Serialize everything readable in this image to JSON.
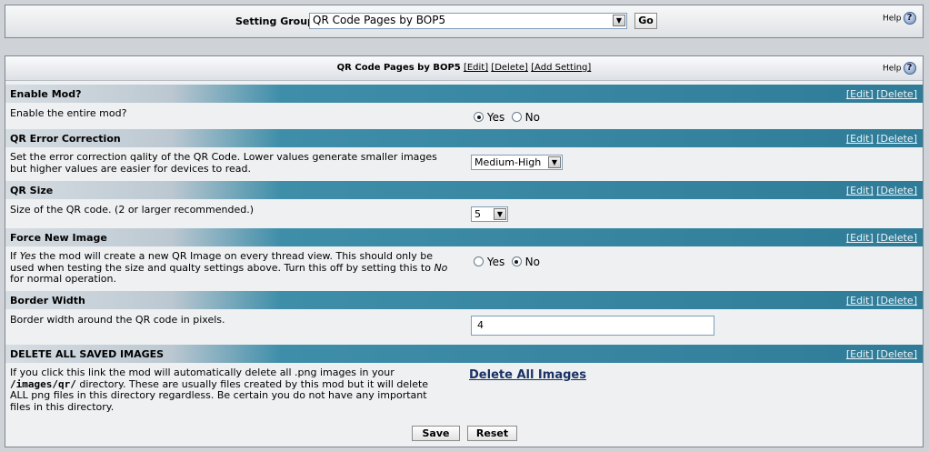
{
  "top": {
    "setting_group_label": "Setting Group",
    "setting_group_value": "QR Code Pages by BOP5",
    "go_label": "Go",
    "help_label": "Help",
    "help_icon": "?"
  },
  "main": {
    "title": "QR Code Pages by BOP5",
    "edit": "[Edit]",
    "delete": "[Delete]",
    "add_setting": "[Add Setting]",
    "help_label": "Help",
    "help_icon": "?"
  },
  "sections": [
    {
      "title": "Enable Mod?",
      "edit": "[Edit]",
      "delete": "[Delete]",
      "description": "Enable the entire mod?",
      "yes": "Yes",
      "no": "No",
      "selected": "Yes"
    },
    {
      "title": "QR Error Correction",
      "edit": "[Edit]",
      "delete": "[Delete]",
      "description_line1": "Set the error correction qality of the QR Code. Lower values generate smaller images",
      "description_line2": "but higher values are easier for devices to read.",
      "value": "Medium-High"
    },
    {
      "title": "QR Size",
      "edit": "[Edit]",
      "delete": "[Delete]",
      "description": "Size of the QR code. (2 or larger recommended.)",
      "value": "5"
    },
    {
      "title": "Force New Image",
      "edit": "[Edit]",
      "delete": "[Delete]",
      "d_if": "If ",
      "d_yes": "Yes",
      "d_line1_rest": " the mod will create a new QR Image on every thread view. This should only be",
      "d_line2": "used when testing the size and qualty settings above. Turn this off by setting this to ",
      "d_no": "No",
      "d_line3": "for normal operation.",
      "yes": "Yes",
      "no": "No",
      "selected": "No"
    },
    {
      "title": "Border Width",
      "edit": "[Edit]",
      "delete": "[Delete]",
      "description": "Border width around the QR code in pixels.",
      "value": "4"
    },
    {
      "title": "DELETE ALL SAVED IMAGES",
      "edit": "[Edit]",
      "delete": "[Delete]",
      "d_line1": "If you click this link the mod will automatically delete all .png images in your",
      "d_path": "/images/qr/",
      "d_line2_rest": " directory. These are usually files created by this mod but it will delete",
      "d_line3": "ALL png files in this directory regardless. Be certain you do not have any important",
      "d_line4": "files in this directory.",
      "action": "Delete All Images"
    }
  ],
  "footer": {
    "save": "Save",
    "reset": "Reset"
  }
}
